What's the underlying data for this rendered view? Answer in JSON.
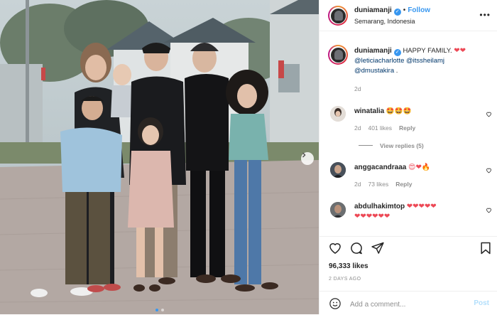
{
  "photo": {
    "alt_icons": [
      "chevron-right-icon"
    ],
    "carousel": {
      "count": 2,
      "active": 0
    }
  },
  "header": {
    "username": "duniamanji",
    "separator": "•",
    "follow_label": "Follow",
    "location": "Semarang, Indonesia",
    "more_label": "•••"
  },
  "caption": {
    "username": "duniamanji",
    "text": "HAPPY FAMILY.",
    "mentions": [
      "@leticiacharlotte",
      "@itssheilamj",
      "@dmustakira",
      "."
    ],
    "hearts": "❤❤",
    "age": "2d"
  },
  "comments": [
    {
      "username": "winatalia",
      "text": "🤩🤩🤩",
      "age": "2d",
      "likes": "401 likes",
      "reply": "Reply",
      "view_replies": "View replies (5)"
    },
    {
      "username": "anggacandraaa",
      "text": "😍❤🔥",
      "age": "2d",
      "likes": "73 likes",
      "reply": "Reply"
    },
    {
      "username": "abdulhakimtop",
      "text": "❤❤❤❤❤",
      "text2": "❤❤❤❤❤❤"
    }
  ],
  "footer": {
    "likes": "96,333 likes",
    "date": "2 DAYS AGO",
    "comment_placeholder": "Add a comment...",
    "post_label": "Post"
  },
  "colors": {
    "accent": "#3897f0",
    "heart": "#ed4956",
    "muted": "#8e8e8e",
    "text": "#262626"
  }
}
